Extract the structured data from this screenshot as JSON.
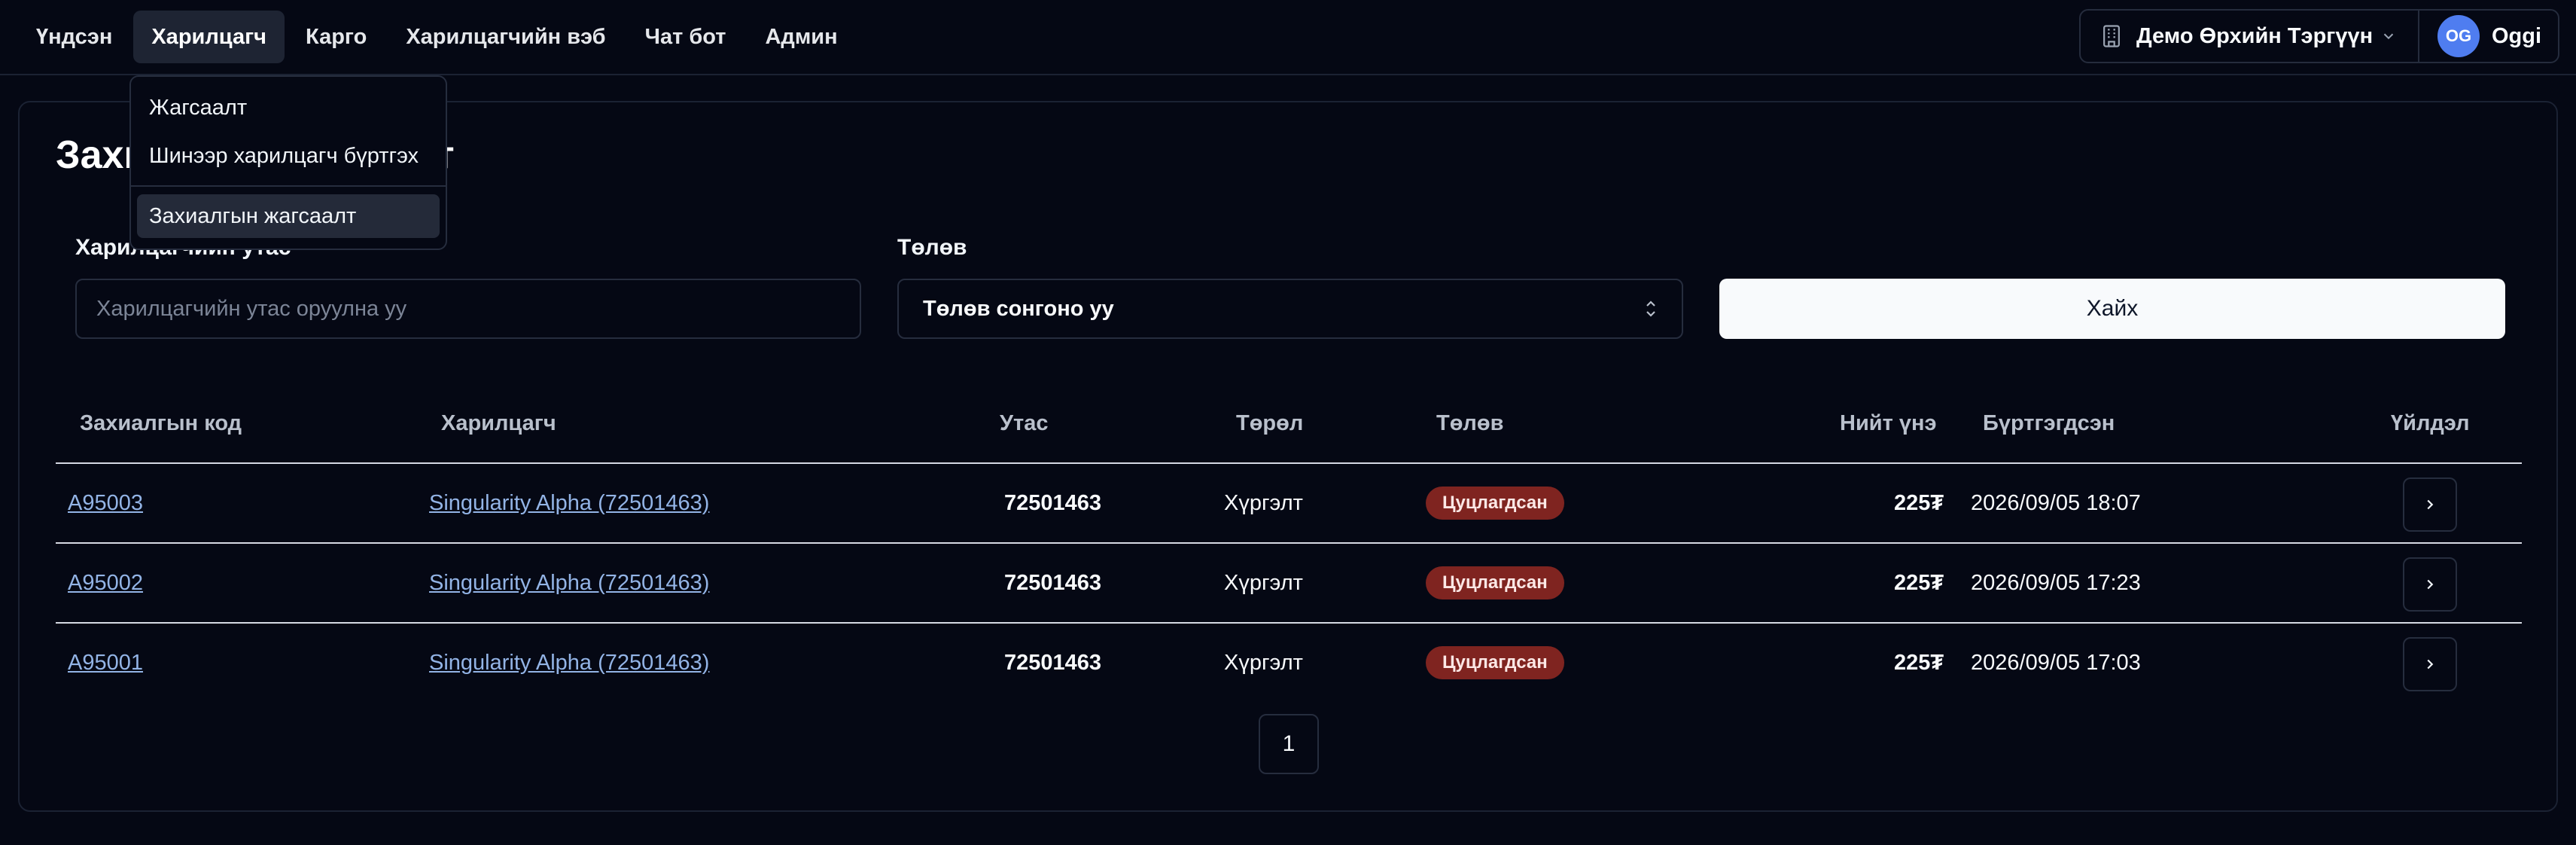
{
  "nav": {
    "items": [
      "Үндсэн",
      "Харилцагч",
      "Карго",
      "Харилцагчийн вэб",
      "Чат бот",
      "Админ"
    ],
    "active_index": 1
  },
  "org": {
    "name": "Демо Өрхийн Тэргүүн",
    "icon": "building-icon"
  },
  "user": {
    "initials": "OG",
    "name": "Oggi"
  },
  "dropdown": {
    "items": [
      "Жагсаалт",
      "Шинээр харилцагч бүртгэх",
      "Захиалгын жагсаалт"
    ],
    "active_index": 2
  },
  "page": {
    "title": "Захиалгын жагсаалт"
  },
  "filters": {
    "phone_label": "Харилцагчийн утас",
    "phone_placeholder": "Харилцагчийн утас оруулна уу",
    "payment_label": "Төлөв",
    "payment_value": "Төлөв сонгоно уу",
    "search_label": "Хайх"
  },
  "table": {
    "headers": [
      "Захиалгын код",
      "Харилцагч",
      "Утас",
      "Төрөл",
      "Төлөв",
      "Нийт үнэ",
      "Бүртгэгдсэн",
      "Үйлдэл"
    ],
    "rows": [
      {
        "code": "A95003",
        "customer": "Singularity Alpha (72501463)",
        "phone": "72501463",
        "type": "Хүргэлт",
        "status": "Цуцлагдсан",
        "total": "225₮",
        "created": "2026/09/05 18:07"
      },
      {
        "code": "A95002",
        "customer": "Singularity Alpha (72501463)",
        "phone": "72501463",
        "type": "Хүргэлт",
        "status": "Цуцлагдсан",
        "total": "225₮",
        "created": "2026/09/05 17:23"
      },
      {
        "code": "A95001",
        "customer": "Singularity Alpha (72501463)",
        "phone": "72501463",
        "type": "Хүргэлт",
        "status": "Цуцлагдсан",
        "total": "225₮",
        "created": "2026/09/05 17:03"
      }
    ]
  },
  "pagination": {
    "current": "1"
  },
  "colors": {
    "background": "#050814",
    "accent": "#4f7df0",
    "status_cancelled": "#7f2420",
    "link": "#93b4e6"
  }
}
